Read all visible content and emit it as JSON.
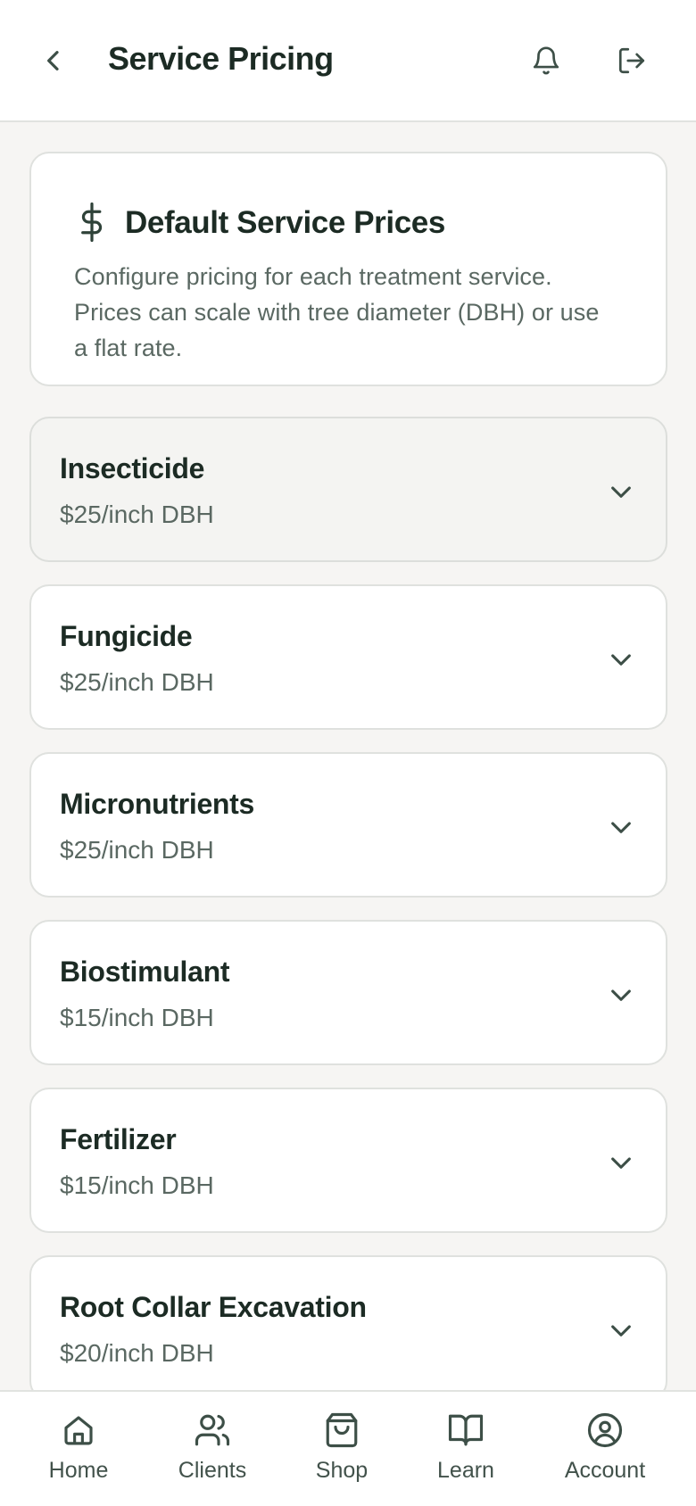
{
  "header": {
    "title": "Service Pricing",
    "icons": {
      "back": "chevron-left-icon",
      "notifications": "bell-icon",
      "logout": "logout-icon"
    }
  },
  "intro": {
    "icon": "dollar-sign-icon",
    "title": "Default Service Prices",
    "description": "Configure pricing for each treatment service. Prices can scale with tree diameter (DBH) or use a flat rate."
  },
  "services": [
    {
      "name": "Insecticide",
      "price": "$25/inch DBH"
    },
    {
      "name": "Fungicide",
      "price": "$25/inch DBH"
    },
    {
      "name": "Micronutrients",
      "price": "$25/inch DBH"
    },
    {
      "name": "Biostimulant",
      "price": "$15/inch DBH"
    },
    {
      "name": "Fertilizer",
      "price": "$15/inch DBH"
    },
    {
      "name": "Root Collar Excavation",
      "price": "$20/inch DBH"
    }
  ],
  "nav": [
    {
      "label": "Home",
      "icon": "home-icon"
    },
    {
      "label": "Clients",
      "icon": "users-icon"
    },
    {
      "label": "Shop",
      "icon": "shopping-bag-icon"
    },
    {
      "label": "Learn",
      "icon": "book-open-icon"
    },
    {
      "label": "Account",
      "icon": "user-circle-icon"
    }
  ],
  "colors": {
    "text": "#1c2b24",
    "muted": "#5a6862",
    "background": "#f6f5f3",
    "card": "#ffffff",
    "border": "#dfe1de"
  }
}
